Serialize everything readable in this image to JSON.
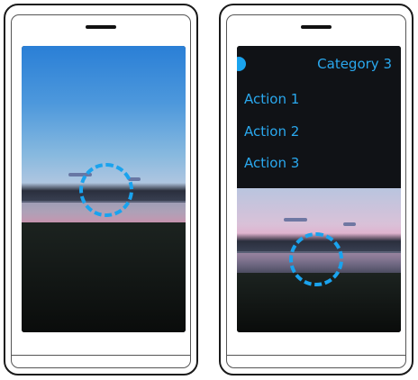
{
  "menu": {
    "category_label": "Category 3",
    "items": [
      {
        "label": "Action 1"
      },
      {
        "label": "Action 2"
      },
      {
        "label": "Action 3"
      }
    ]
  },
  "colors": {
    "accent": "#1aa3ee",
    "menu_background": "#101216",
    "phone_outline": "#1a1a1a"
  },
  "icons": {
    "touch_indicator": "dashed-circle-icon",
    "menu_indicator": "dot-icon"
  }
}
